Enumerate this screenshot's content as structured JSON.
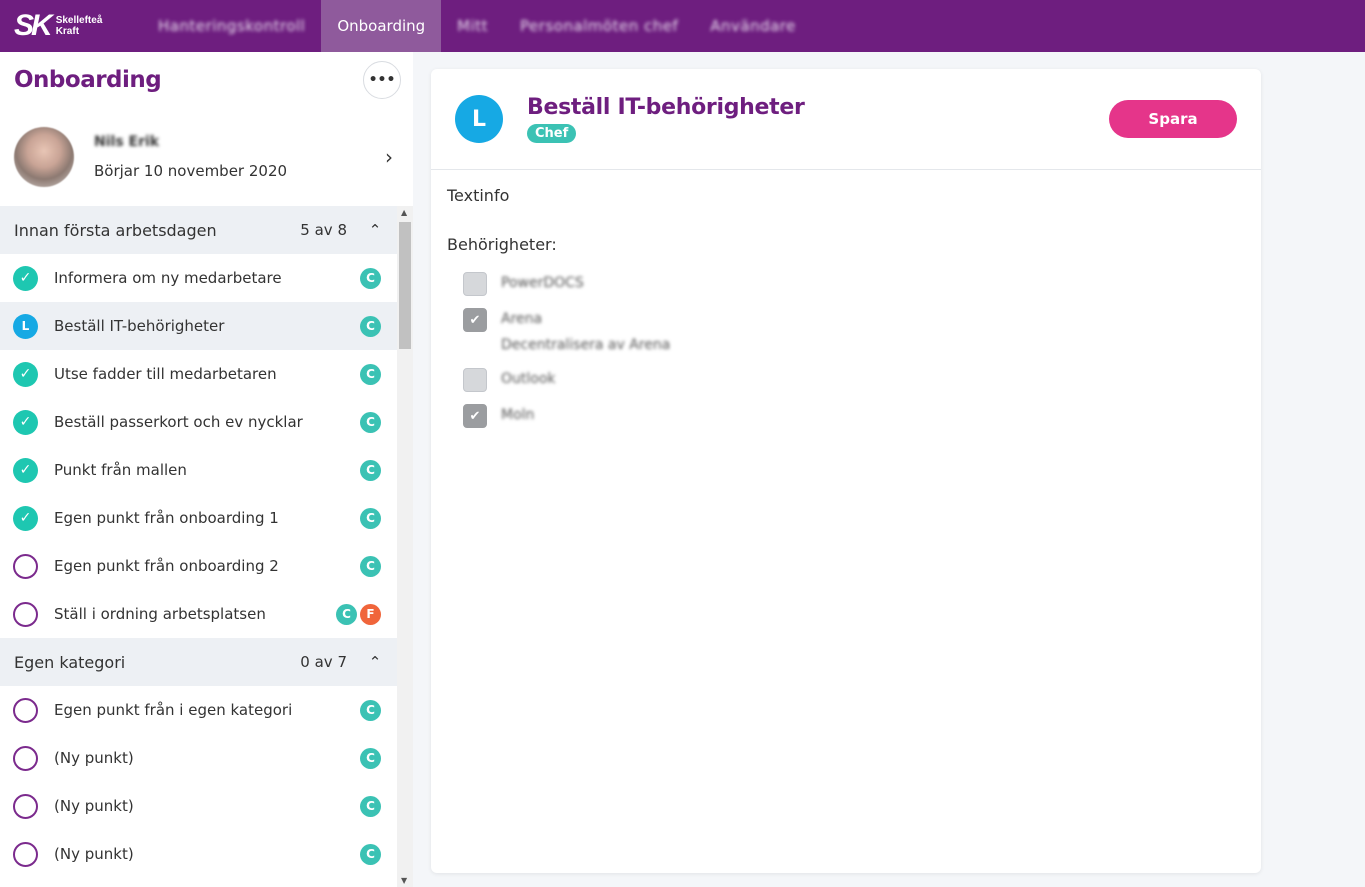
{
  "nav": {
    "logo_mark": "SK",
    "logo_line1": "Skellefteå",
    "logo_line2": "Kraft",
    "items": [
      {
        "label": "Hanteringskontroll"
      },
      {
        "label": "Onboarding"
      },
      {
        "label": "Mitt"
      },
      {
        "label": "Personalmöten chef"
      },
      {
        "label": "Användare"
      }
    ]
  },
  "sidebar": {
    "title": "Onboarding",
    "more": "•••",
    "person": {
      "name": "Nils Erik",
      "start": "Börjar 10 november 2020",
      "chevron": "›"
    },
    "categories": [
      {
        "name": "Innan första arbetsdagen",
        "count": "5 av 8",
        "items": [
          {
            "label": "Informera om ny medarbetare",
            "status": "done",
            "badges": [
              "C"
            ]
          },
          {
            "label": "Beställ IT-behörigheter",
            "status": "progress",
            "badges": [
              "C"
            ]
          },
          {
            "label": "Utse fadder till medarbetaren",
            "status": "done",
            "badges": [
              "C"
            ]
          },
          {
            "label": "Beställ passerkort och ev nycklar",
            "status": "done",
            "badges": [
              "C"
            ]
          },
          {
            "label": "Punkt från mallen",
            "status": "done",
            "badges": [
              "C"
            ]
          },
          {
            "label": "Egen punkt från onboarding 1",
            "status": "done",
            "badges": [
              "C"
            ]
          },
          {
            "label": "Egen punkt från onboarding 2",
            "status": "open",
            "badges": [
              "C"
            ]
          },
          {
            "label": "Ställ i ordning arbetsplatsen",
            "status": "open",
            "badges": [
              "C",
              "F"
            ]
          }
        ]
      },
      {
        "name": "Egen kategori",
        "count": "0 av 7",
        "items": [
          {
            "label": "Egen punkt från i egen kategori",
            "status": "open",
            "badges": [
              "C"
            ]
          },
          {
            "label": "(Ny punkt)",
            "status": "open",
            "badges": [
              "C"
            ]
          },
          {
            "label": "(Ny punkt)",
            "status": "open",
            "badges": [
              "C"
            ]
          },
          {
            "label": "(Ny punkt)",
            "status": "open",
            "badges": [
              "C"
            ]
          }
        ]
      }
    ]
  },
  "main": {
    "status_letter": "L",
    "title": "Beställ IT-behörigheter",
    "role": "Chef",
    "save_label": "Spara",
    "textinfo": "Textinfo",
    "permissions_label": "Behörigheter:",
    "permissions": [
      {
        "label": "PowerDOCS",
        "checked": false,
        "sub": ""
      },
      {
        "label": "Arena",
        "checked": true,
        "sub": "Decentralisera av Arena"
      },
      {
        "label": "Outlook",
        "checked": false,
        "sub": ""
      },
      {
        "label": "Moln",
        "checked": true,
        "sub": ""
      }
    ]
  },
  "colors": {
    "brand": "#6e1e7f",
    "accent": "#e5358a",
    "done": "#1ec7b1",
    "progress": "#16a9e4"
  },
  "icons": {
    "done": "check-icon",
    "progress": "clock-icon",
    "open": "circle-icon",
    "chevron_up": "chevron-up-icon"
  }
}
